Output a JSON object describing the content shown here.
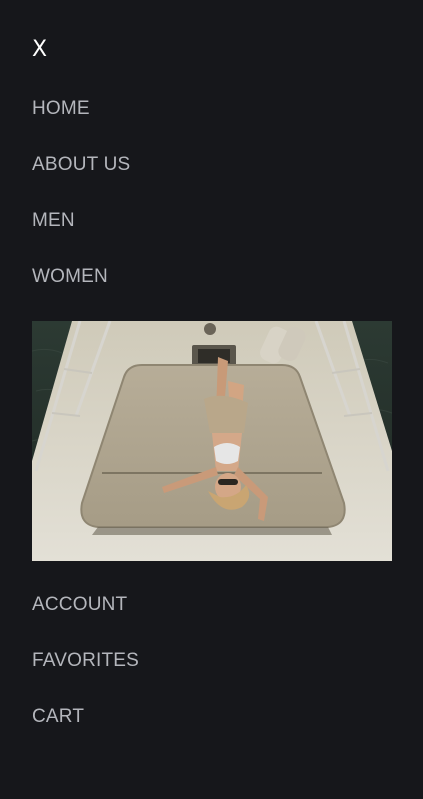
{
  "menu": {
    "close_label": "X",
    "primary_items": [
      {
        "label": "HOME"
      },
      {
        "label": "ABOUT US"
      },
      {
        "label": "MEN"
      },
      {
        "label": "WOMEN"
      }
    ],
    "secondary_items": [
      {
        "label": "ACCOUNT"
      },
      {
        "label": "FAVORITES"
      },
      {
        "label": "CART"
      }
    ],
    "promo_image": {
      "subject": "woman lying on the bow deck of a yacht, seen from above"
    }
  },
  "colors": {
    "background": "#16171b",
    "link": "#b4b6bc",
    "close": "#ffffff"
  }
}
